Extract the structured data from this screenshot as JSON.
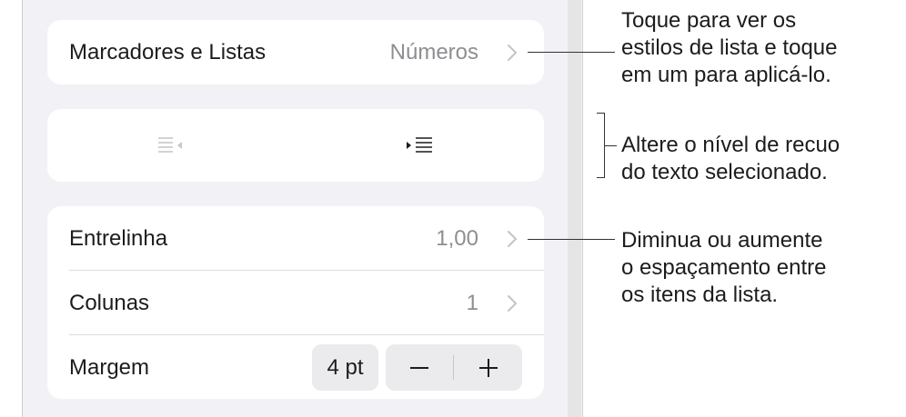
{
  "settings": {
    "bullets": {
      "label": "Marcadores e Listas",
      "value": "Números"
    },
    "indent": {
      "decrease_icon": "outdent-icon",
      "increase_icon": "indent-icon"
    },
    "line_spacing": {
      "label": "Entrelinha",
      "value": "1,00"
    },
    "columns": {
      "label": "Colunas",
      "value": "1"
    },
    "margin": {
      "label": "Margem",
      "value": "4 pt",
      "decrease_symbol": "minus-icon",
      "increase_symbol": "plus-icon"
    }
  },
  "callouts": {
    "bullets": [
      "Toque para ver os",
      "estilos de lista e toque",
      "em um para aplicá-lo."
    ],
    "indent": [
      "Altere o nível de recuo",
      "do texto selecionado."
    ],
    "spacing": [
      "Diminua ou aumente",
      "o espaçamento entre",
      "os itens da lista."
    ]
  },
  "colors": {
    "panel_background": "#f2f2f6",
    "card_background": "#ffffff",
    "secondary_text": "#8e8e93",
    "disabled_icon": "#c7c7cc"
  }
}
